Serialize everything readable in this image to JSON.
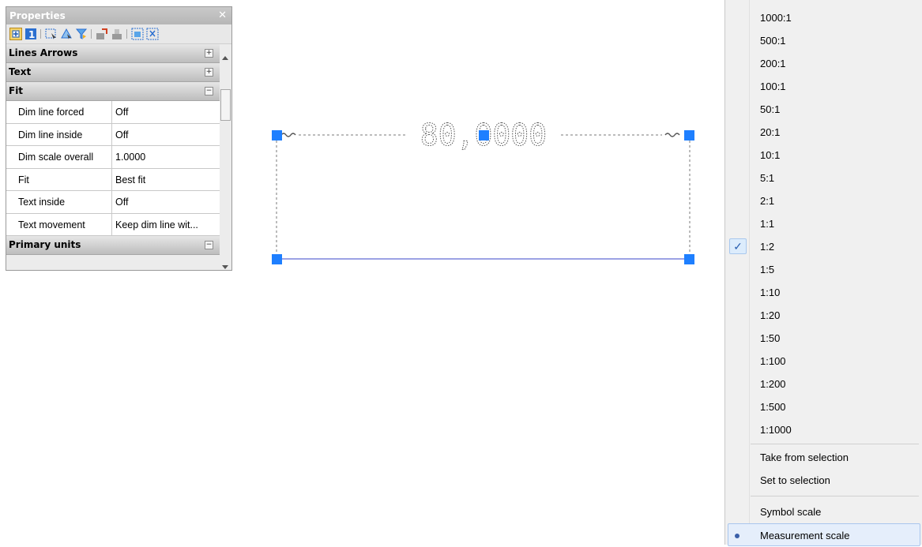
{
  "properties": {
    "title": "Properties",
    "sections": {
      "lines_arrows": "Lines  Arrows",
      "text": "Text",
      "fit": "Fit",
      "primary_units": "Primary units"
    },
    "fit_rows": [
      {
        "name": "Dim line forced",
        "value": "Off"
      },
      {
        "name": "Dim line inside",
        "value": "Off"
      },
      {
        "name": "Dim scale overall",
        "value": "1.0000"
      },
      {
        "name": "Fit",
        "value": "Best fit"
      },
      {
        "name": "Text inside",
        "value": "Off"
      },
      {
        "name": "Text movement",
        "value": "Keep dim line wit..."
      }
    ]
  },
  "drawing": {
    "dimension_text": "80,0000",
    "grip_color": "#1e7fff",
    "baseline_color": "#3a46c8"
  },
  "menu": {
    "scales": [
      "1000:1",
      "500:1",
      "200:1",
      "100:1",
      "50:1",
      "20:1",
      "10:1",
      "5:1",
      "2:1",
      "1:1",
      "1:2",
      "1:5",
      "1:10",
      "1:20",
      "1:50",
      "1:100",
      "1:200",
      "1:500",
      "1:1000"
    ],
    "checked_scale": "1:2",
    "take_from_selection": "Take from selection",
    "set_to_selection": "Set to selection",
    "symbol_scale": "Symbol scale",
    "measurement_scale": "Measurement scale",
    "selected_mode": "Measurement scale"
  }
}
